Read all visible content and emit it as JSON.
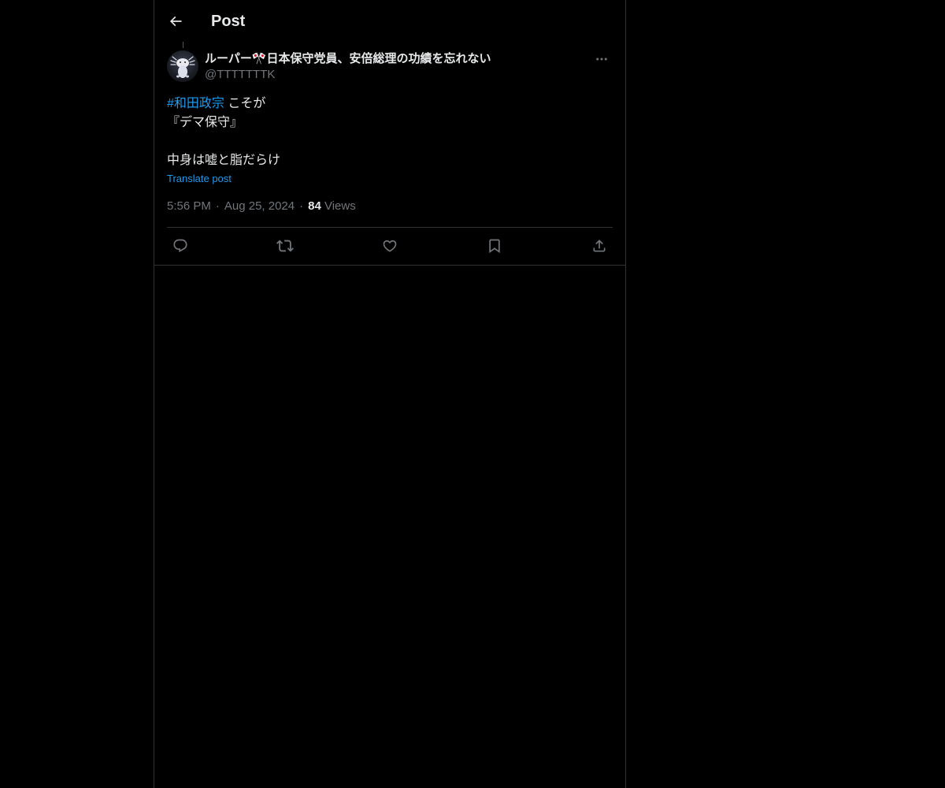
{
  "header": {
    "title": "Post",
    "back_icon": "arrow-left-icon"
  },
  "post": {
    "author": {
      "display_name": "ルーパー🎌日本保守党員、安倍総理の功績を忘れない",
      "handle": "@TTTTTTTK",
      "avatar_icon": "axolotl-avatar"
    },
    "more_icon": "more-horizontal-icon",
    "body": {
      "hashtag": "#和田政宗",
      "line1_rest": " こそが",
      "line2": "『デマ保守』",
      "line3": "",
      "line4": "中身は嘘と脂だらけ"
    },
    "translate_label": "Translate post",
    "time": "5:56 PM",
    "separator": "·",
    "date": "Aug 25, 2024",
    "views_count": "84",
    "views_label": "Views"
  },
  "actions": {
    "reply_icon": "reply-icon",
    "repost_icon": "repost-icon",
    "like_icon": "heart-icon",
    "bookmark_icon": "bookmark-icon",
    "share_icon": "share-icon"
  },
  "colors": {
    "background": "#000000",
    "text": "#e7e9ea",
    "muted": "#71767b",
    "accent": "#1d9bf0",
    "border": "#2f3336"
  }
}
